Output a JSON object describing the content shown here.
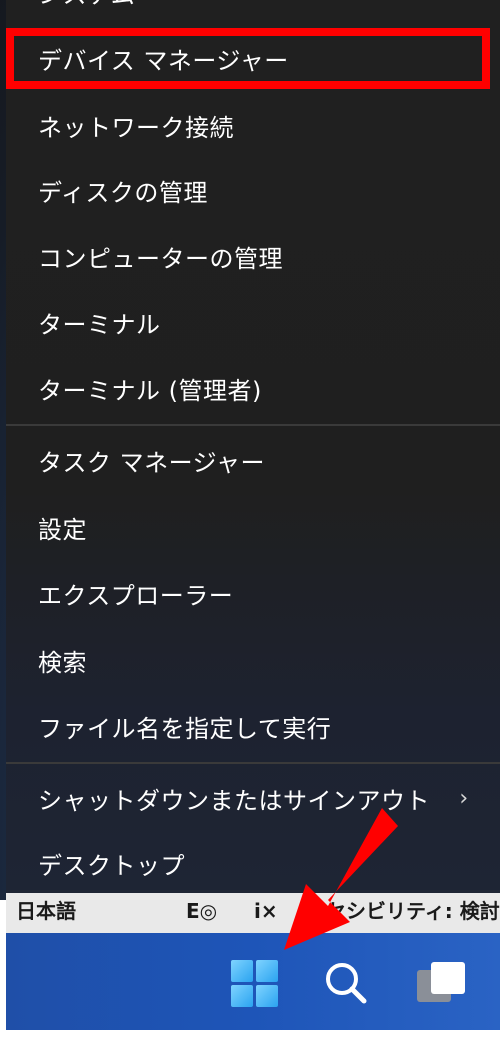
{
  "menu": {
    "partial_top_label": "システム",
    "items": [
      {
        "label": "デバイス マネージャー"
      },
      {
        "label": "ネットワーク接続"
      },
      {
        "label": "ディスクの管理"
      },
      {
        "label": "コンピューターの管理"
      },
      {
        "label": "ターミナル"
      },
      {
        "label": "ターミナル (管理者)"
      },
      {
        "label": "タスク マネージャー"
      },
      {
        "label": "設定"
      },
      {
        "label": "エクスプローラー"
      },
      {
        "label": "検索"
      },
      {
        "label": "ファイル名を指定して実行"
      },
      {
        "label": "シャットダウンまたはサインアウト",
        "chevron": "›"
      },
      {
        "label": "デスクトップ"
      }
    ]
  },
  "status_strip": {
    "language": "日本語",
    "icon1_glyph": "E◎",
    "icon2_glyph": "ⅰ×",
    "accessibility_text": "セシビリティ: 検討"
  },
  "taskbar": {
    "start_icon": "windows-logo-icon",
    "search_icon": "search-icon",
    "taskview_icon": "task-view-icon"
  },
  "colors": {
    "highlight": "#ff0000",
    "arrow": "#ff0000",
    "taskbar": "#1e55b8",
    "menu_bg": "#202020"
  }
}
